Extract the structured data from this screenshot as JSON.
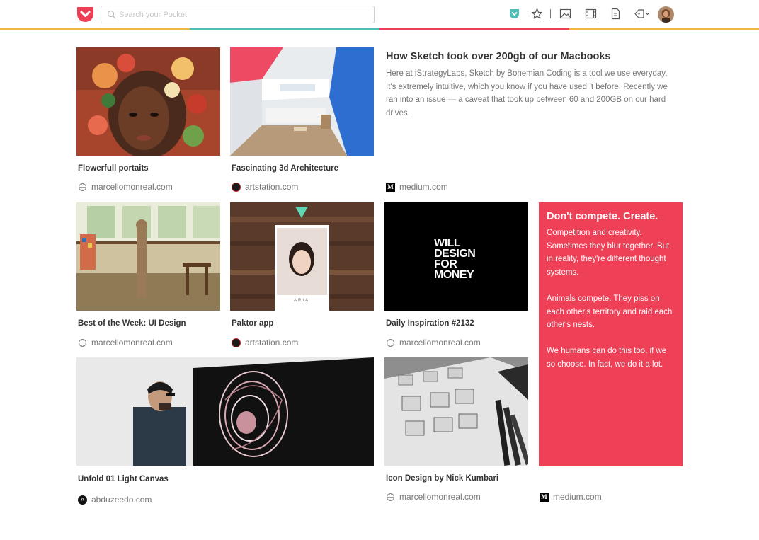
{
  "colors": {
    "brand": "#ef3f56",
    "accent_teal": "#50bcb6",
    "quote_bg": "#ee4056",
    "rainbow": [
      "#f0b642",
      "#50bcb6",
      "#ef3f56",
      "#f0b642"
    ]
  },
  "header": {
    "logo_icon": "pocket-logo",
    "search_placeholder": "Search your Pocket",
    "icons": [
      "pocket-save-icon",
      "star-icon",
      "image-icon",
      "film-icon",
      "document-icon",
      "tag-icon",
      "chevron-down-icon",
      "avatar"
    ]
  },
  "items": [
    {
      "title": "Flowerfull portaits",
      "source": "marcellomonreal.com"
    },
    {
      "title": "Fascinating 3d Architecture",
      "source": "artstation.com"
    },
    {
      "title": "How Sketch took over 200gb of our Macbooks",
      "excerpt": "Here at iStrategyLabs, Sketch by Bohemian Coding is a tool we use everyday. It's extremely intuitive, which you know if you have used it before! Recently we ran into an issue — a caveat that took up between 60 and 200GB on our hard drives.",
      "source": "medium.com"
    },
    {
      "title": "Best of the Week: UI Design",
      "source": "marcellomonreal.com"
    },
    {
      "title": "Paktor app",
      "source": "artstation.com"
    },
    {
      "title": "Daily Inspiration #2132",
      "source": "marcellomonreal.com",
      "image_text": [
        "WILL",
        "DESIGN",
        "FOR",
        "MONEY"
      ]
    },
    {
      "title": "Unfold 01 Light Canvas",
      "source": "abduzeedo.com"
    },
    {
      "title": "Icon Design by Nick Kumbari",
      "source": "marcellomonreal.com"
    }
  ],
  "quote_card": {
    "title": "Don't compete. Create.",
    "paragraphs": [
      "Competition and creativity. Sometimes they blur together. But in reality, they're different thought systems.",
      "Animals compete. They piss on each other's territory and raid each other's nests.",
      "We humans can do this too, if we so choose. In fact, we do it a lot."
    ],
    "source": "medium.com"
  },
  "favicons": {
    "m_letter": "M",
    "a_letter": "A",
    "paktor_card": "ARIA"
  }
}
